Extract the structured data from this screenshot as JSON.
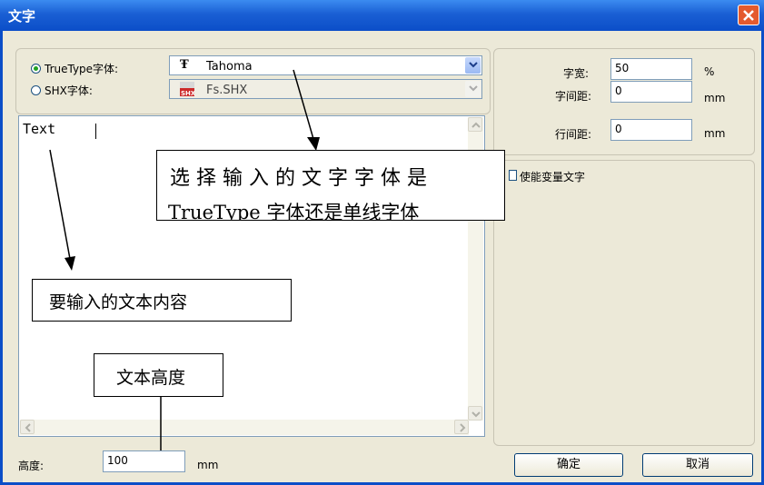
{
  "window": {
    "title": "文字"
  },
  "font_group": {
    "truetype_label": "TrueType字体:",
    "truetype_selected": true,
    "truetype_value": "Tahoma",
    "truetype_icon": "truetype-font-icon",
    "shx_label": "SHX字体:",
    "shx_selected": false,
    "shx_value": "Fs.SHX",
    "shx_icon": "shx-font-icon"
  },
  "text_area": {
    "value": "Text"
  },
  "annotations": {
    "font_choice_line1": "选 择 输 入 的 文 字 字 体 是",
    "font_choice_line2": "TrueType 字体还是单线字体",
    "text_content": "要输入的文本内容",
    "text_height": "文本高度"
  },
  "right_panel": {
    "char_width_label": "字宽:",
    "char_width_value": "50",
    "char_width_unit": "%",
    "char_spacing_label": "字间距:",
    "char_spacing_value": "0",
    "char_spacing_unit": "mm",
    "line_spacing_label": "行间距:",
    "line_spacing_value": "0",
    "line_spacing_unit": "mm",
    "variable_text_label": "使能变量文字",
    "variable_text_checked": false
  },
  "height": {
    "label": "高度:",
    "value": "100",
    "unit": "mm"
  },
  "buttons": {
    "ok": "确定",
    "cancel": "取消"
  },
  "colors": {
    "title_bar": "#1a5fd4",
    "close_button": "#e45a2e",
    "dialog_bg": "#ece9d8",
    "input_border": "#7f9db9"
  }
}
